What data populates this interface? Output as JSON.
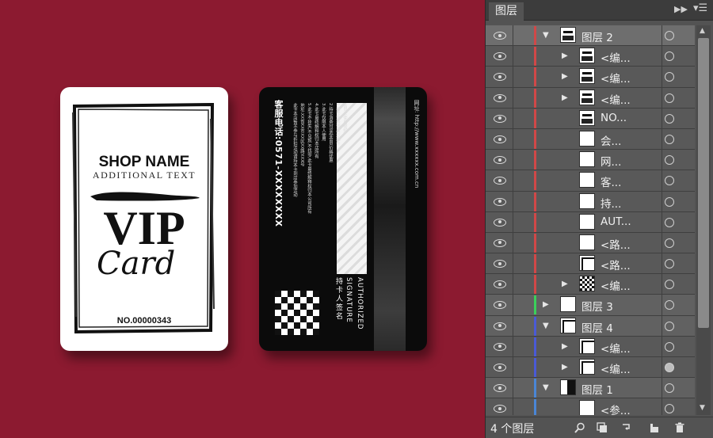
{
  "front_card": {
    "shop_name": "SHOP NAME",
    "additional_text": "ADDITIONAL TEXT",
    "vip": "VIP",
    "card_script": "Card",
    "number": "NO.00000343"
  },
  "back_card": {
    "hotline": "客服电话:0571-XXXXXXXX",
    "rules": [
      "会员卡使用须知:",
      "1.持卡消费请出示此卡",
      "2.持卡消费可享受会员价格优惠",
      "3.此卡仅限本人使用",
      "4.此卡最终解释权归本店所有",
      "5.此卡不挂失,不兑现,不找零,此卡最终解释权归本公司所有",
      "地址:XX省XX市XX区XX路XXX号",
      "此卡本店暂不参与折扣活动请持本卡到店参加活动"
    ],
    "website": "网址: http://www.xxxxxx.com.cn",
    "authorized": "AUTHORIZED",
    "signature": "SIGNATURE",
    "holder_sign": "持卡人签名"
  },
  "layers_panel": {
    "tab_title": "图层",
    "collapse_icon": "double-chevron-right-icon",
    "menu_icon": "panel-menu-icon",
    "layers": [
      {
        "name": "图层 2",
        "level": "top",
        "expanded": true,
        "color": "#d04848",
        "selected": true,
        "thumb": "card-front"
      },
      {
        "name": "<编...",
        "level": "child",
        "has_children": true,
        "color": "#d04848",
        "thumb": "stripes"
      },
      {
        "name": "<编...",
        "level": "child",
        "has_children": true,
        "color": "#d04848",
        "thumb": "vip"
      },
      {
        "name": "<编...",
        "level": "child",
        "has_children": true,
        "color": "#d04848",
        "thumb": "line"
      },
      {
        "name": "NO...",
        "level": "child",
        "has_children": false,
        "color": "#d04848",
        "thumb": "no"
      },
      {
        "name": "会...",
        "level": "child",
        "has_children": false,
        "color": "#d04848",
        "thumb": "blank"
      },
      {
        "name": "网...",
        "level": "child",
        "has_children": false,
        "color": "#d04848",
        "thumb": "blank"
      },
      {
        "name": "客...",
        "level": "child",
        "has_children": false,
        "color": "#d04848",
        "thumb": "blank"
      },
      {
        "name": "持...",
        "level": "child",
        "has_children": false,
        "color": "#d04848",
        "thumb": "blank"
      },
      {
        "name": "AUT...",
        "level": "child",
        "has_children": false,
        "color": "#d04848",
        "thumb": "blank"
      },
      {
        "name": "<路...",
        "level": "child",
        "has_children": false,
        "color": "#d04848",
        "thumb": "blank"
      },
      {
        "name": "<路...",
        "level": "child",
        "has_children": false,
        "color": "#d04848",
        "thumb": "frame"
      },
      {
        "name": "<编...",
        "level": "child",
        "has_children": true,
        "color": "#d04848",
        "thumb": "checker"
      },
      {
        "name": "图层 3",
        "level": "top",
        "expanded": false,
        "color": "#3bd05a",
        "thumb": "blank"
      },
      {
        "name": "图层 4",
        "level": "top",
        "expanded": true,
        "color": "#4a5ad6",
        "thumb": "frame"
      },
      {
        "name": "<编...",
        "level": "child",
        "has_children": true,
        "color": "#4a5ad6",
        "thumb": "frame"
      },
      {
        "name": "<编...",
        "level": "child",
        "has_children": true,
        "color": "#4a5ad6",
        "thumb": "frame",
        "target_filled": true
      },
      {
        "name": "图层 1",
        "level": "top",
        "expanded": true,
        "color": "#4a86d6",
        "thumb": "blackside"
      },
      {
        "name": "<参...",
        "level": "child",
        "has_children": false,
        "color": "#4a86d6",
        "thumb": "blank"
      }
    ],
    "footer": {
      "layer_count": "4 个图层",
      "icons": [
        "search-icon",
        "make-clipping-mask-icon",
        "create-sublayer-icon",
        "new-layer-icon",
        "delete-icon"
      ]
    }
  }
}
